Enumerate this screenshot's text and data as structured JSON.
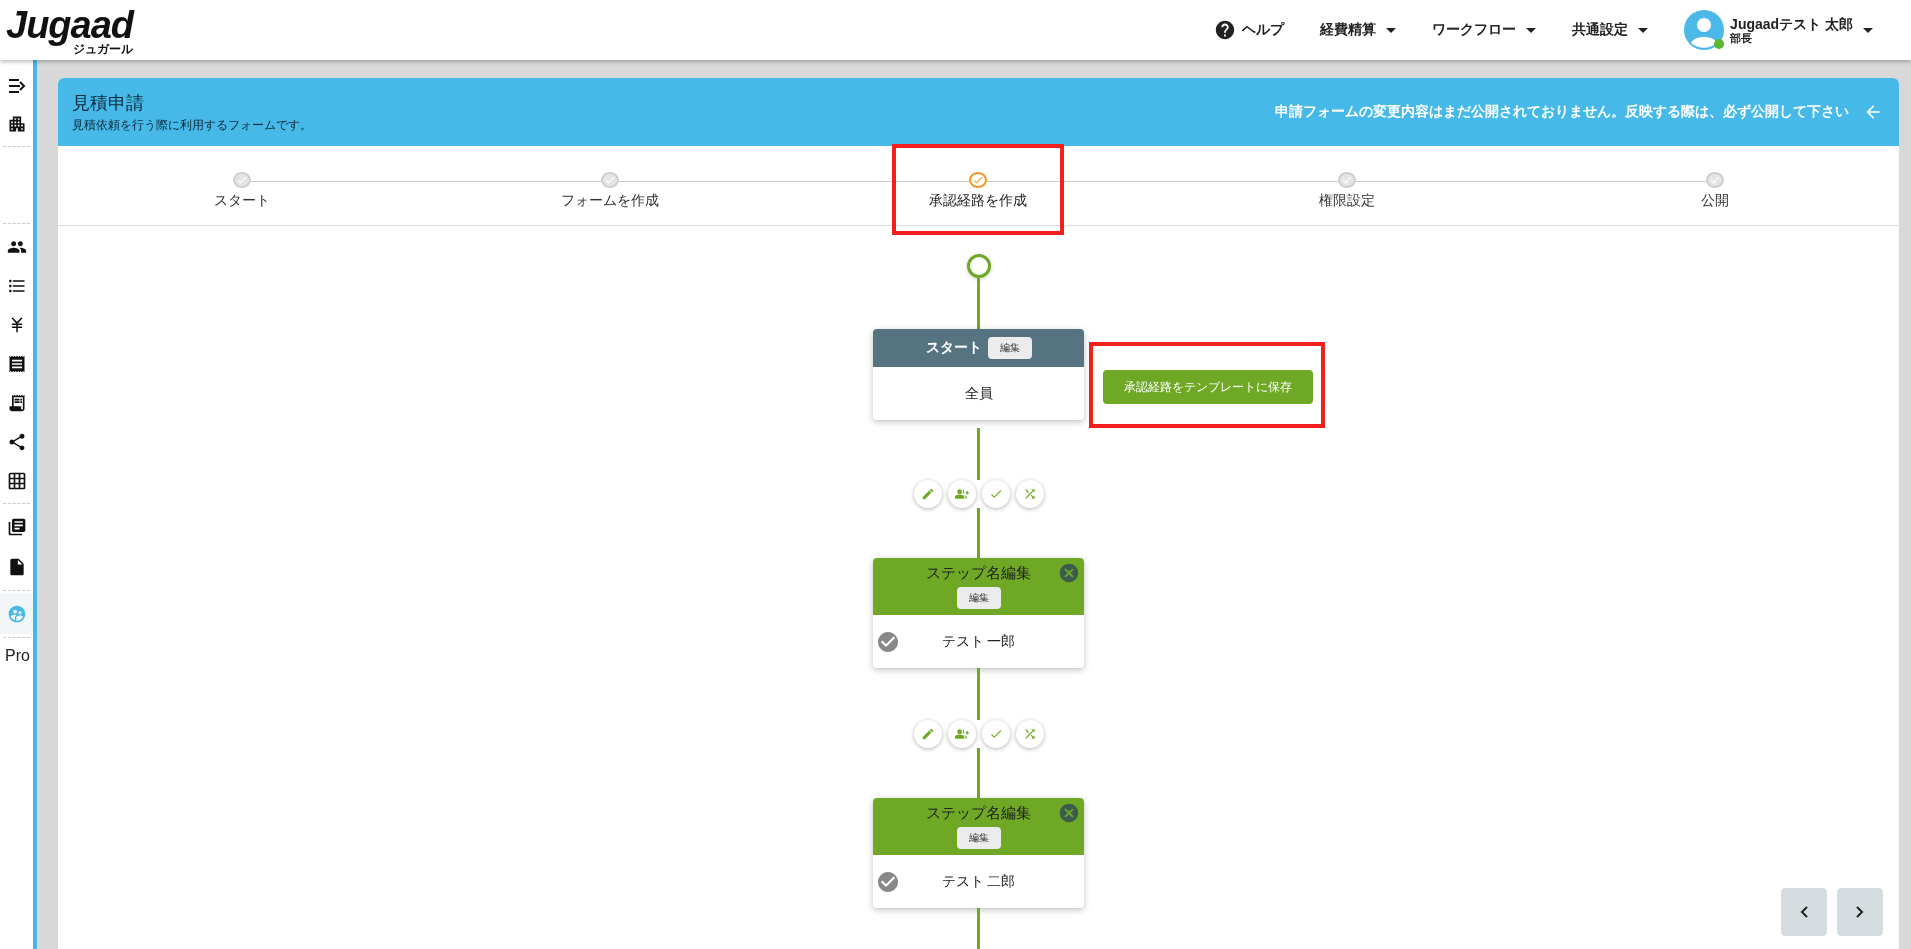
{
  "header": {
    "logo": "Jugaad",
    "logo_sub": "ジュガール",
    "nav": [
      {
        "label": "ヘルプ",
        "kind": "help"
      },
      {
        "label": "経費精算",
        "kind": "menu"
      },
      {
        "label": "ワークフロー",
        "kind": "menu"
      },
      {
        "label": "共通設定",
        "kind": "menu"
      }
    ],
    "user": {
      "name": "Jugaadテスト 太郎",
      "role": "部長",
      "online": true
    }
  },
  "sidebar": {
    "sections": [
      {
        "items": [
          {
            "selected": false
          },
          {
            "selected": false
          }
        ]
      },
      {
        "items": [
          {
            "selected": false
          },
          {
            "selected": false
          },
          {
            "selected": false
          },
          {
            "selected": false
          },
          {
            "selected": false
          },
          {
            "selected": false
          },
          {
            "selected": false
          }
        ]
      },
      {
        "items": [
          {
            "selected": false
          },
          {
            "selected": false
          }
        ]
      },
      {
        "items": [
          {
            "selected": true
          }
        ]
      }
    ],
    "footer": "Pro"
  },
  "banner": {
    "title": "見積申請",
    "subtitle": "見積依頼を行う際に利用するフォームです。",
    "notice": "申請フォームの変更内容はまだ公開されておりません。反映する際は、必ず公開して下さい"
  },
  "stepper": {
    "steps": [
      {
        "label": "スタート",
        "selected": false,
        "highlighted": false
      },
      {
        "label": "フォームを作成",
        "selected": false,
        "highlighted": false
      },
      {
        "label": "承認経路を作成",
        "selected": true,
        "highlighted": true
      },
      {
        "label": "権限設定",
        "selected": false,
        "highlighted": false
      },
      {
        "label": "公開",
        "selected": false,
        "highlighted": false
      }
    ]
  },
  "flow": {
    "start": {
      "title": "スタート",
      "edit": "編集",
      "assignee": "全員"
    },
    "save_template": {
      "label": "承認経路をテンプレートに保存",
      "highlighted": true
    },
    "steps": [
      {
        "title": "ステップ名編集",
        "edit": "編集",
        "approver": "テスト 一郎"
      },
      {
        "title": "ステップ名編集",
        "edit": "編集",
        "approver": "テスト 二郎"
      }
    ]
  }
}
